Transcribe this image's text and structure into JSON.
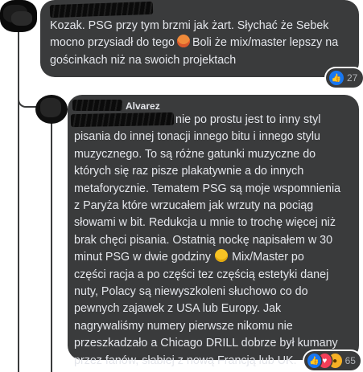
{
  "comments": [
    {
      "author_visible": "",
      "lines": [
        "Kozak. PSG przy tym brzmi jak żart. Słychać że Sebek",
        "mocno przysiadł do tego",
        "Boli że mix/master lepszy na",
        "gościnkach niż na swoich projektach"
      ],
      "emoji_name": "hot-face-emoji",
      "reactions": {
        "types": [
          "like"
        ],
        "count": "27"
      }
    },
    {
      "author_visible": "Alvarez",
      "lines": [
        "nie po prostu jest to inny styl",
        "pisania do innej tonacji innego bitu i innego stylu",
        "muzycznego. To są różne gatunki muzyczne do",
        "których się raz pisze plakatywnie a do innych",
        "metaforycznie. Tematem PSG są moje wspomnienia",
        "z Paryża które wrzucałem jak wrzuty na pociąg",
        "słowami w bit. Redukcja u mnie to trochę więcej niż",
        "brak chęci pisania. Ostatnią nockę napisałem w 30",
        "minut PSG w dwie godziny",
        "Mix/Master po",
        "części racja a po części tez częścią estetyki danej",
        "nuty, Polacy są niewyszkoleni słuchowo co do",
        "pewnych zajawek z USA lub Europy. Jak",
        "nagrywaliśmy numery pierwsze nikomu nie",
        "przeszkadzało a Chicago DRILL dobrze był kumany",
        "przez fanów, słabiej z nową Francją lub UK."
      ],
      "emoji_name": "smiling-face-emoji",
      "reactions": {
        "types": [
          "like",
          "love",
          "wow"
        ],
        "count": "65"
      }
    }
  ]
}
